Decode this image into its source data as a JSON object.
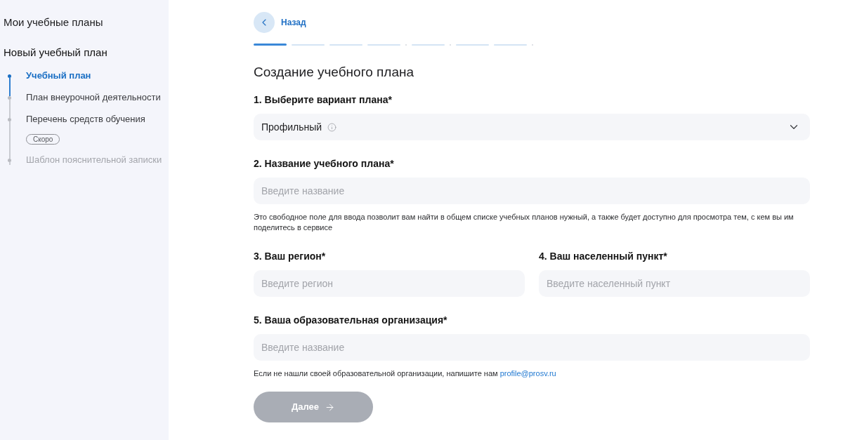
{
  "sidebar": {
    "title": "Мои учебные планы",
    "section_title": "Новый учебный план",
    "steps": [
      {
        "label": "Учебный план",
        "selected": true,
        "disabled": false
      },
      {
        "label": "План внеурочной деятельности",
        "selected": false,
        "disabled": false
      },
      {
        "label": "Перечень средств обучения",
        "selected": false,
        "disabled": false,
        "badge": "Скоро"
      },
      {
        "label": "Шаблон пояснительной записки",
        "selected": false,
        "disabled": true
      }
    ]
  },
  "back_link": {
    "label": "Назад"
  },
  "progress": [
    {
      "kind": "segment",
      "active": true
    },
    {
      "kind": "segment",
      "active": false
    },
    {
      "kind": "segment",
      "active": false
    },
    {
      "kind": "segment",
      "active": false
    },
    {
      "kind": "dot",
      "active": false
    },
    {
      "kind": "segment",
      "active": false
    },
    {
      "kind": "dot",
      "active": false
    },
    {
      "kind": "segment",
      "active": false
    },
    {
      "kind": "segment",
      "active": false
    },
    {
      "kind": "dot",
      "active": false
    }
  ],
  "form": {
    "title": "Создание учебного плана",
    "rows": [
      [
        {
          "kind": "select",
          "label": "1. Выберите вариант плана*",
          "value": "Профильный",
          "info": true
        }
      ],
      [
        {
          "kind": "text",
          "label": "2. Название учебного плана*",
          "placeholder": "Введите название",
          "hint": "Это свободное поле для ввода позволит вам найти в общем списке учебных планов нужный, а также будет доступно для просмотра тем, с кем вы им поделитесь в сервисе"
        }
      ],
      [
        {
          "kind": "text",
          "label": "3. Ваш регион*",
          "placeholder": "Введите регион"
        },
        {
          "kind": "text",
          "label": "4. Ваш населенный пункт*",
          "placeholder": "Введите населенный пункт"
        }
      ],
      [
        {
          "kind": "text",
          "label": "5. Ваша образовательная организация*",
          "placeholder": "Введите название",
          "hint": "Если не нашли своей образовательной организации, напишите нам",
          "hint_link": "profile@prosv.ru"
        }
      ]
    ],
    "submit": {
      "label": "Далее",
      "disabled": true
    }
  }
}
